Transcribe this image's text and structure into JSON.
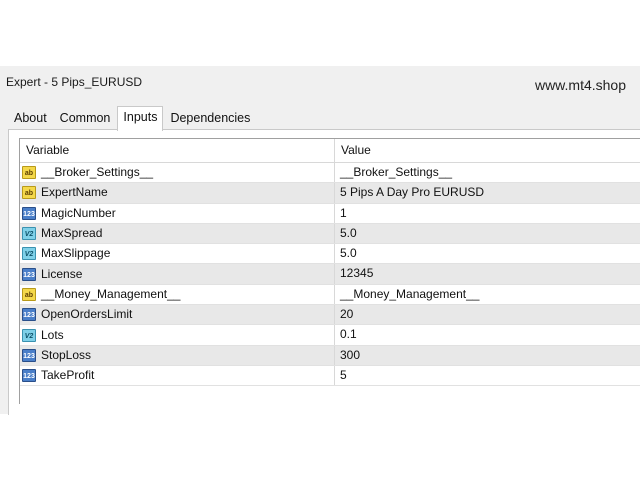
{
  "window": {
    "title": "Expert - 5 Pips_EURUSD",
    "watermark": "www.mt4.shop"
  },
  "tabs": [
    {
      "label": "About"
    },
    {
      "label": "Common"
    },
    {
      "label": "Inputs",
      "active": true
    },
    {
      "label": "Dependencies"
    }
  ],
  "table": {
    "headers": {
      "variable": "Variable",
      "value": "Value"
    },
    "rows": [
      {
        "icon": "string-type-icon",
        "variable": "__Broker_Settings__",
        "value": "__Broker_Settings__"
      },
      {
        "icon": "string-type-icon",
        "variable": "ExpertName",
        "value": "5 Pips A Day Pro EURUSD"
      },
      {
        "icon": "integer-type-icon",
        "variable": "MagicNumber",
        "value": "1"
      },
      {
        "icon": "double-type-icon",
        "variable": "MaxSpread",
        "value": "5.0"
      },
      {
        "icon": "double-type-icon",
        "variable": "MaxSlippage",
        "value": "5.0"
      },
      {
        "icon": "integer-type-icon",
        "variable": "License",
        "value": "12345"
      },
      {
        "icon": "string-type-icon",
        "variable": "__Money_Management__",
        "value": "__Money_Management__"
      },
      {
        "icon": "integer-type-icon",
        "variable": "OpenOrdersLimit",
        "value": "20"
      },
      {
        "icon": "double-type-icon",
        "variable": "Lots",
        "value": "0.1"
      },
      {
        "icon": "integer-type-icon",
        "variable": "StopLoss",
        "value": "300"
      },
      {
        "icon": "integer-type-icon",
        "variable": "TakeProfit",
        "value": "5"
      }
    ]
  }
}
